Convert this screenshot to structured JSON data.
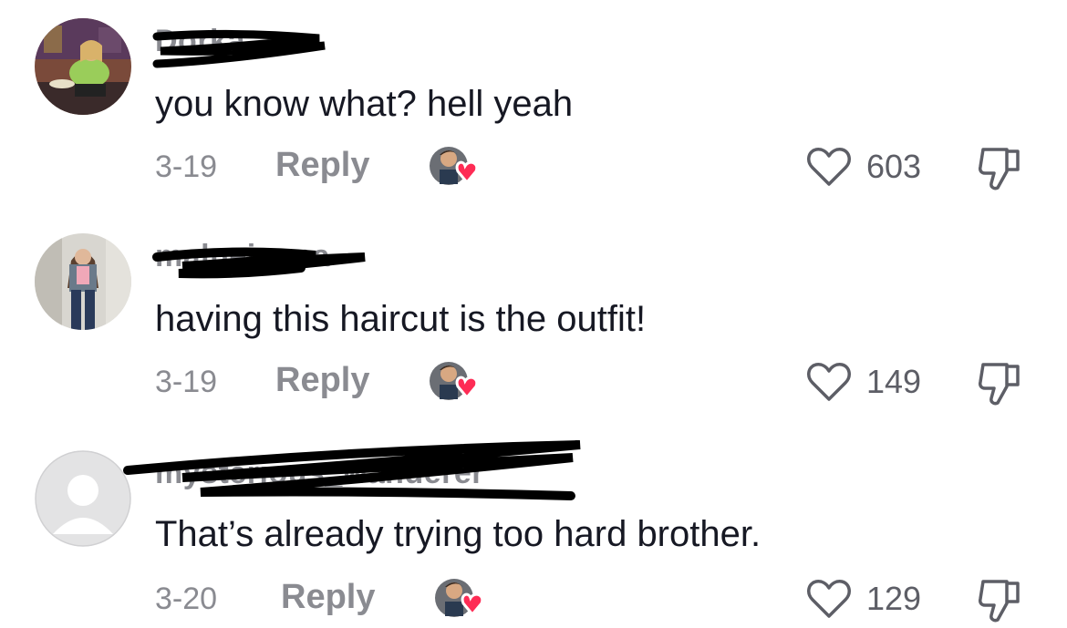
{
  "comments": [
    {
      "username": "Dorka",
      "text": "you know what? hell yeah",
      "date": "3-19",
      "reply_label": "Reply",
      "likes": "603"
    },
    {
      "username": "malnejuana",
      "text": "having this haircut is the outfit!",
      "date": "3-19",
      "reply_label": "Reply",
      "likes": "149"
    },
    {
      "username": "mysterious_wanderer",
      "text": "That’s already trying too hard brother.",
      "date": "3-20",
      "reply_label": "Reply",
      "likes": "129"
    }
  ],
  "colors": {
    "liked_by_creator_heart": "#fe2c55",
    "secondary_text": "#8a8b91",
    "primary_text": "#161823"
  }
}
